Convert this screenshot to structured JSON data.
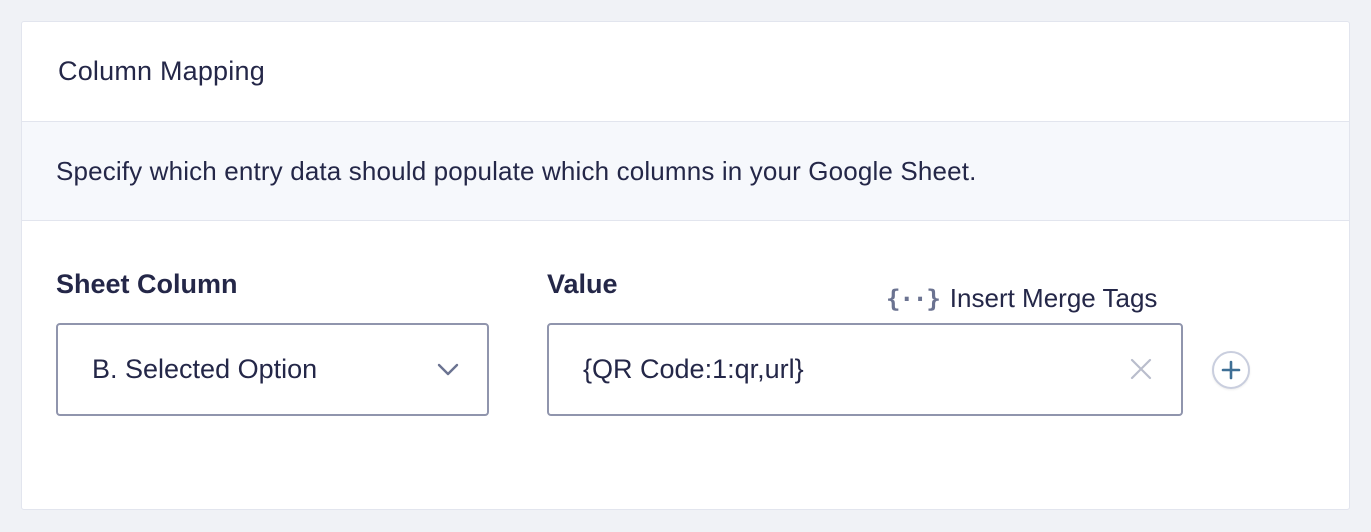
{
  "card": {
    "title": "Column Mapping",
    "description": "Specify which entry data should populate which columns in your Google Sheet."
  },
  "mapping": {
    "sheet_column_label": "Sheet Column",
    "value_label": "Value",
    "merge_tags_icon": "{··}",
    "merge_tags_label": "Insert Merge Tags",
    "selected_column": "B. Selected Option",
    "value": "{QR Code:1:qr,url}"
  },
  "icons": {
    "merge_tags": "curly-braces-icon",
    "dropdown": "chevron-down-icon",
    "clear": "close-icon",
    "add": "plus-icon"
  },
  "colors": {
    "text": "#242748",
    "border": "#9095ad",
    "muted_icon": "#6b7391",
    "add_icon": "#3e6f95",
    "desc_background": "#f6f8fc"
  }
}
